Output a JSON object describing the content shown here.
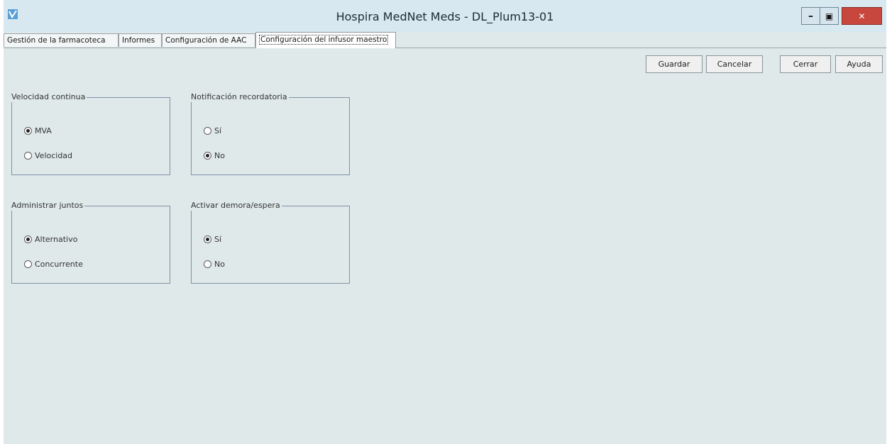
{
  "window": {
    "title": "Hospira MedNet Meds - DL_Plum13-01",
    "controls": {
      "minimize": "–",
      "restore": "▣",
      "close": "✕"
    }
  },
  "tabs": [
    {
      "label": "Gestión de la farmacoteca"
    },
    {
      "label": "Informes"
    },
    {
      "label": "Configuración de AAC"
    },
    {
      "label": "Configuración del infusor maestro"
    }
  ],
  "active_tab": "Configuración del infusor maestro",
  "toolbar": {
    "save": "Guardar",
    "cancel": "Cancelar",
    "close": "Cerrar",
    "help": "Ayuda"
  },
  "groups": {
    "velocidad_continua": {
      "title": "Velocidad continua",
      "options": [
        {
          "label": "MVA",
          "selected": true
        },
        {
          "label": "Velocidad",
          "selected": false
        }
      ]
    },
    "notificacion_recordatoria": {
      "title": "Notificación recordatoria",
      "options": [
        {
          "label": "Sí",
          "selected": false
        },
        {
          "label": "No",
          "selected": true
        }
      ]
    },
    "administrar_juntos": {
      "title": "Administrar juntos",
      "options": [
        {
          "label": "Alternativo",
          "selected": true
        },
        {
          "label": "Concurrente",
          "selected": false
        }
      ]
    },
    "activar_demora": {
      "title": "Activar demora/espera",
      "options": [
        {
          "label": "Sí",
          "selected": true
        },
        {
          "label": "No",
          "selected": false
        }
      ]
    }
  },
  "colors": {
    "background": "#dfe9ea",
    "titlebar": "#d7e8f1",
    "close_button": "#c7463d",
    "group_border": "#7f91a8"
  },
  "icons": {
    "app": "mednet-app-icon"
  }
}
